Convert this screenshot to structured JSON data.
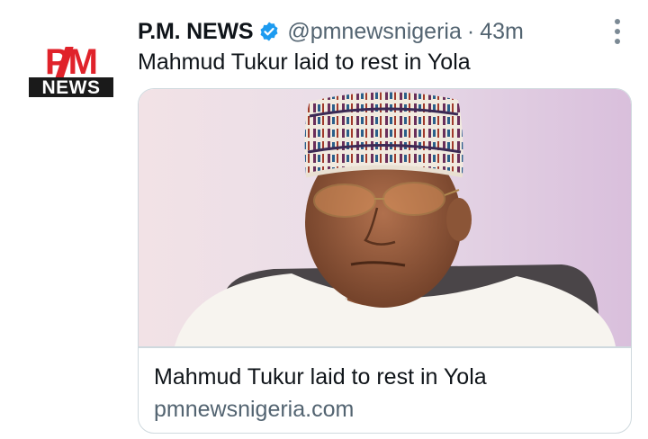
{
  "tweet": {
    "author": {
      "display_name": "P.M. NEWS",
      "verified": true,
      "handle": "@pmnewsnigeria",
      "avatar_logo_text": [
        "PM",
        "NEWS"
      ]
    },
    "separator": "·",
    "timestamp": "43m",
    "text": "Mahmud Tukur laid to rest in Yola",
    "card": {
      "title": "Mahmud Tukur laid to rest in Yola",
      "domain": "pmnewsnigeria.com"
    }
  },
  "colors": {
    "brand_red": "#e0222a",
    "verified_blue": "#1d9bf0",
    "secondary_text": "#536471",
    "border": "#cfd9de"
  },
  "icons": {
    "verified": "verified-badge-icon",
    "more": "more-options-icon"
  }
}
